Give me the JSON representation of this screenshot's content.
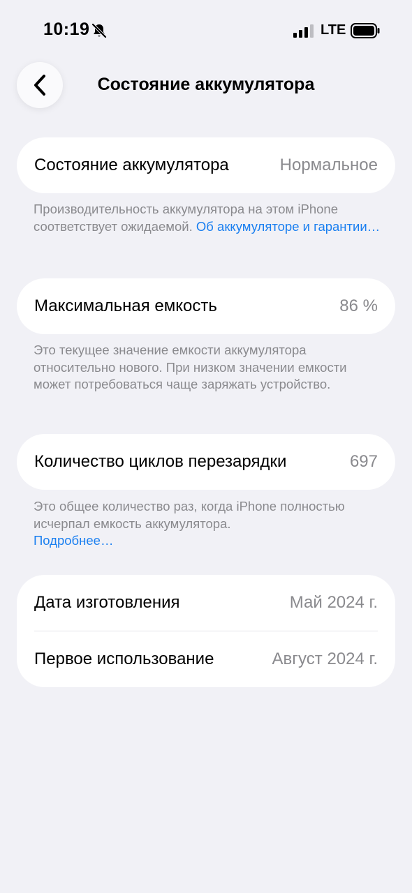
{
  "status_bar": {
    "time": "10:19",
    "network": "LTE",
    "icons": [
      "bell-slash-icon",
      "signal-bars-icon",
      "battery-icon"
    ]
  },
  "nav": {
    "back_icon": "chevron-left-icon",
    "title": "Состояние аккумулятора"
  },
  "health": {
    "label": "Состояние аккумулятора",
    "value": "Нормальное",
    "note": "Производительность аккумулятора на этом iPhone соответствует ожидаемой. ",
    "link": "Об аккумуляторе и гарантии…"
  },
  "capacity": {
    "label": "Максимальная емкость",
    "value": "86 %",
    "note": "Это текущее значение емкости аккумулятора относительно нового. При низком значении емкости может потребоваться чаще заряжать устройство."
  },
  "cycles": {
    "label": "Количество циклов перезарядки",
    "value": "697",
    "note": "Это общее количество раз, когда iPhone полностью исчерпал емкость аккумулятора.",
    "link": "Подробнее…"
  },
  "dates": {
    "manufacture_label": "Дата изготовления",
    "manufacture_value": "Май 2024 г.",
    "first_use_label": "Первое использование",
    "first_use_value": "Август 2024 г."
  },
  "colors": {
    "background": "#f1f1f6",
    "card": "#ffffff",
    "secondary_text": "#8a8a8e",
    "link": "#1a7ff0"
  }
}
